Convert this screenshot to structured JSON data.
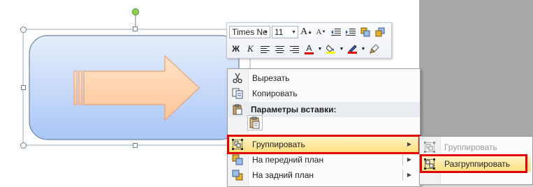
{
  "mini_toolbar": {
    "font_name": "Times Ne",
    "font_size": "11",
    "font_color": "#d40000",
    "highlight_color": "#ffff00",
    "line_color": "#e60000"
  },
  "context_menu": {
    "items": [
      {
        "label": "Вырезать",
        "icon": "scissors-icon"
      },
      {
        "label": "Копировать",
        "icon": "copy-icon"
      }
    ],
    "paste_header": "Параметры вставки:",
    "group_item": {
      "label": "Группировать",
      "icon": "group-icon"
    },
    "front_item": {
      "label": "На передний план",
      "icon": "bring-forward-icon"
    },
    "back_item": {
      "label": "На задний план",
      "icon": "send-backward-icon"
    }
  },
  "submenu": {
    "items": [
      {
        "label": "Группировать",
        "icon": "group-icon",
        "enabled": false
      },
      {
        "label": "Разгруппировать",
        "icon": "ungroup-icon",
        "enabled": true
      }
    ]
  },
  "colors": {
    "highlight_border": "#e00000",
    "selection_gradient_top": "#fff3c8",
    "selection_gradient_bottom": "#ffdf7e"
  }
}
